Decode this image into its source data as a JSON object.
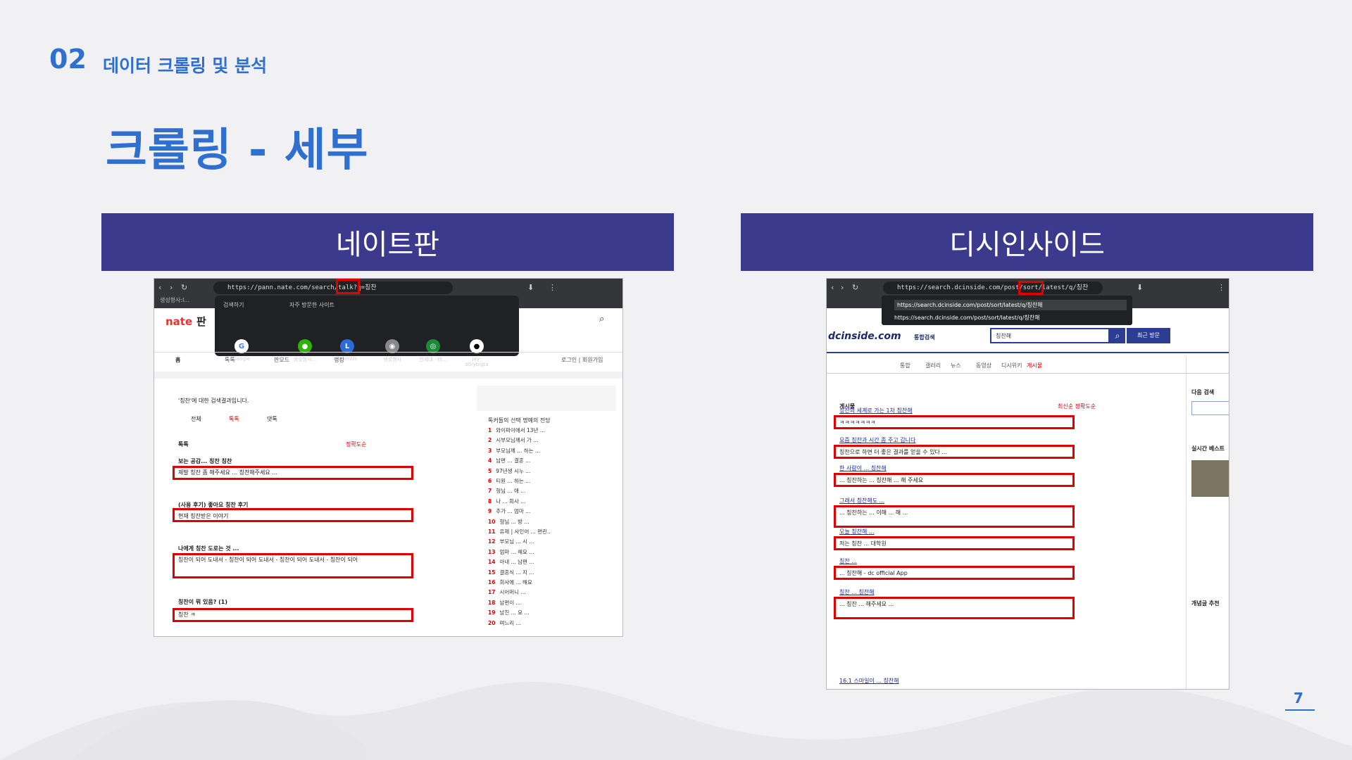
{
  "header": {
    "section_number": "02",
    "section_title": "데이터 크롤링 및 분석",
    "page_title": "크롤링 - 세부"
  },
  "panels": {
    "left_label": "네이트판",
    "right_label": "디시인사이드"
  },
  "nate": {
    "url": "https://pann.nate.com/search/talk?q=",
    "query": "칭찬",
    "bookmark_text": "생성형사:l...",
    "shortcuts_label": "검색하기",
    "recent_label": "자주 방문한 사이트",
    "shortcuts": [
      "Google",
      "생성형사...",
      "LearnUs",
      "생성형사",
      "연세대 - 비...",
      "jay-d0/ybigta"
    ],
    "logo": "nate",
    "logo_suffix": "판",
    "tabs": [
      "홈",
      "톡톡",
      "판모드",
      "랭킹"
    ],
    "login": "로그인 | 회원가입",
    "result_line": "'칭찬'에 대한 검색결과입니다.",
    "filters": [
      "전체",
      "톡톡",
      "댓톡"
    ],
    "section": "톡톡",
    "sort": "정확도순",
    "posts": [
      {
        "title": "보는 공감... 칭찬 칭찬",
        "body": "제발 칭찬 좀 해주세요 ... 칭찬해주세요 ..."
      },
      {
        "title": "(사용 후기) 좋아요 칭찬 후기",
        "body": "현재 칭찬받은 이야기"
      },
      {
        "title": "나에게 칭찬 도로는 것 ...",
        "body": "칭찬이 되어 도내서 - 칭찬이 되어 도내서 - 칭찬이 되어 도내서 - 칭찬이 되어"
      },
      {
        "title": "칭찬이 뭐 있음? (1)",
        "body": "칭찬 ㅋ"
      }
    ],
    "ranking_title": "톡커들의 선택  명예의 전당",
    "ranking": [
      "와이파이에서 13년 ...",
      "시부모님께서 가 ...",
      "부모님께 ... 하는 ...",
      "남편 ... 결혼 ...",
      "97년생 시누 ...",
      "티원 ... 하는 ...",
      "형님 ... 애 ...",
      "나 ... 회사 ...",
      "추가 ... 엄마 ...",
      "형님 ... 방 ...",
      "유제 | 사인어 ... 편린..",
      "부모님 ... 시 ...",
      "엄마 ... 해요 ...",
      "아내 ... 남편 ...",
      "결혼식 ... 지 ...",
      "회사에 ... 해요",
      "시어머니 ...",
      "남편이 ...",
      "남친 ... 요 ...",
      "며느리 ..."
    ]
  },
  "dc": {
    "url": "https://search.dcinside.com/post/sort/latest/q/",
    "query": "칭찬",
    "suggest_1": "https://search.dcinside.com/post/sort/latest/q/칭찬해",
    "suggest_2": "https://search.dcinside.com/post/sort/latest/q/칭찬해",
    "logo": "dcinside.com",
    "logo_suffix": "통합검색",
    "search_value": "칭찬해",
    "search_button": "최근 방문",
    "tabs": [
      "통합",
      "갤러리",
      "뉴스",
      "동영상",
      "디시위키",
      "게시물"
    ],
    "section": "게시물",
    "sort": "최신순  정확도순",
    "posts": [
      {
        "title": "칭찬의 세계로 가는 1차 칭찬해",
        "body": "ㅋㅋㅋㅋㅋㅋㅋ"
      },
      {
        "title": "요즘 칭찬과 시간 좀 주고 갑니다",
        "body": "칭찬으로 하면 더 좋은 결과를 얻을 수 있다 ..."
      },
      {
        "title": "한 사람이 ... 칭찬해",
        "body": "... 칭찬하는 ... 칭찬해 ... 해 주세요"
      },
      {
        "title": "그래서 칭찬해도 ...",
        "body": "... 칭찬하는 ... 이해 ... 해 ..."
      },
      {
        "title": "오늘 칭찬해 ...",
        "body": "저는 칭찬 ... 대학원"
      },
      {
        "title": "칭찬 ...",
        "body": "... 칭찬해 - dc official App"
      },
      {
        "title": "칭찬 ... 칭찬해",
        "body": "... 칭찬 ... 해주세요 ..."
      }
    ],
    "footer_link": "16.1 스마일이 ... 칭찬해",
    "side_title": "다음 검색",
    "side_best": "실시간 베스트",
    "side_gallery": "개념글 추천"
  },
  "page_number": "7"
}
